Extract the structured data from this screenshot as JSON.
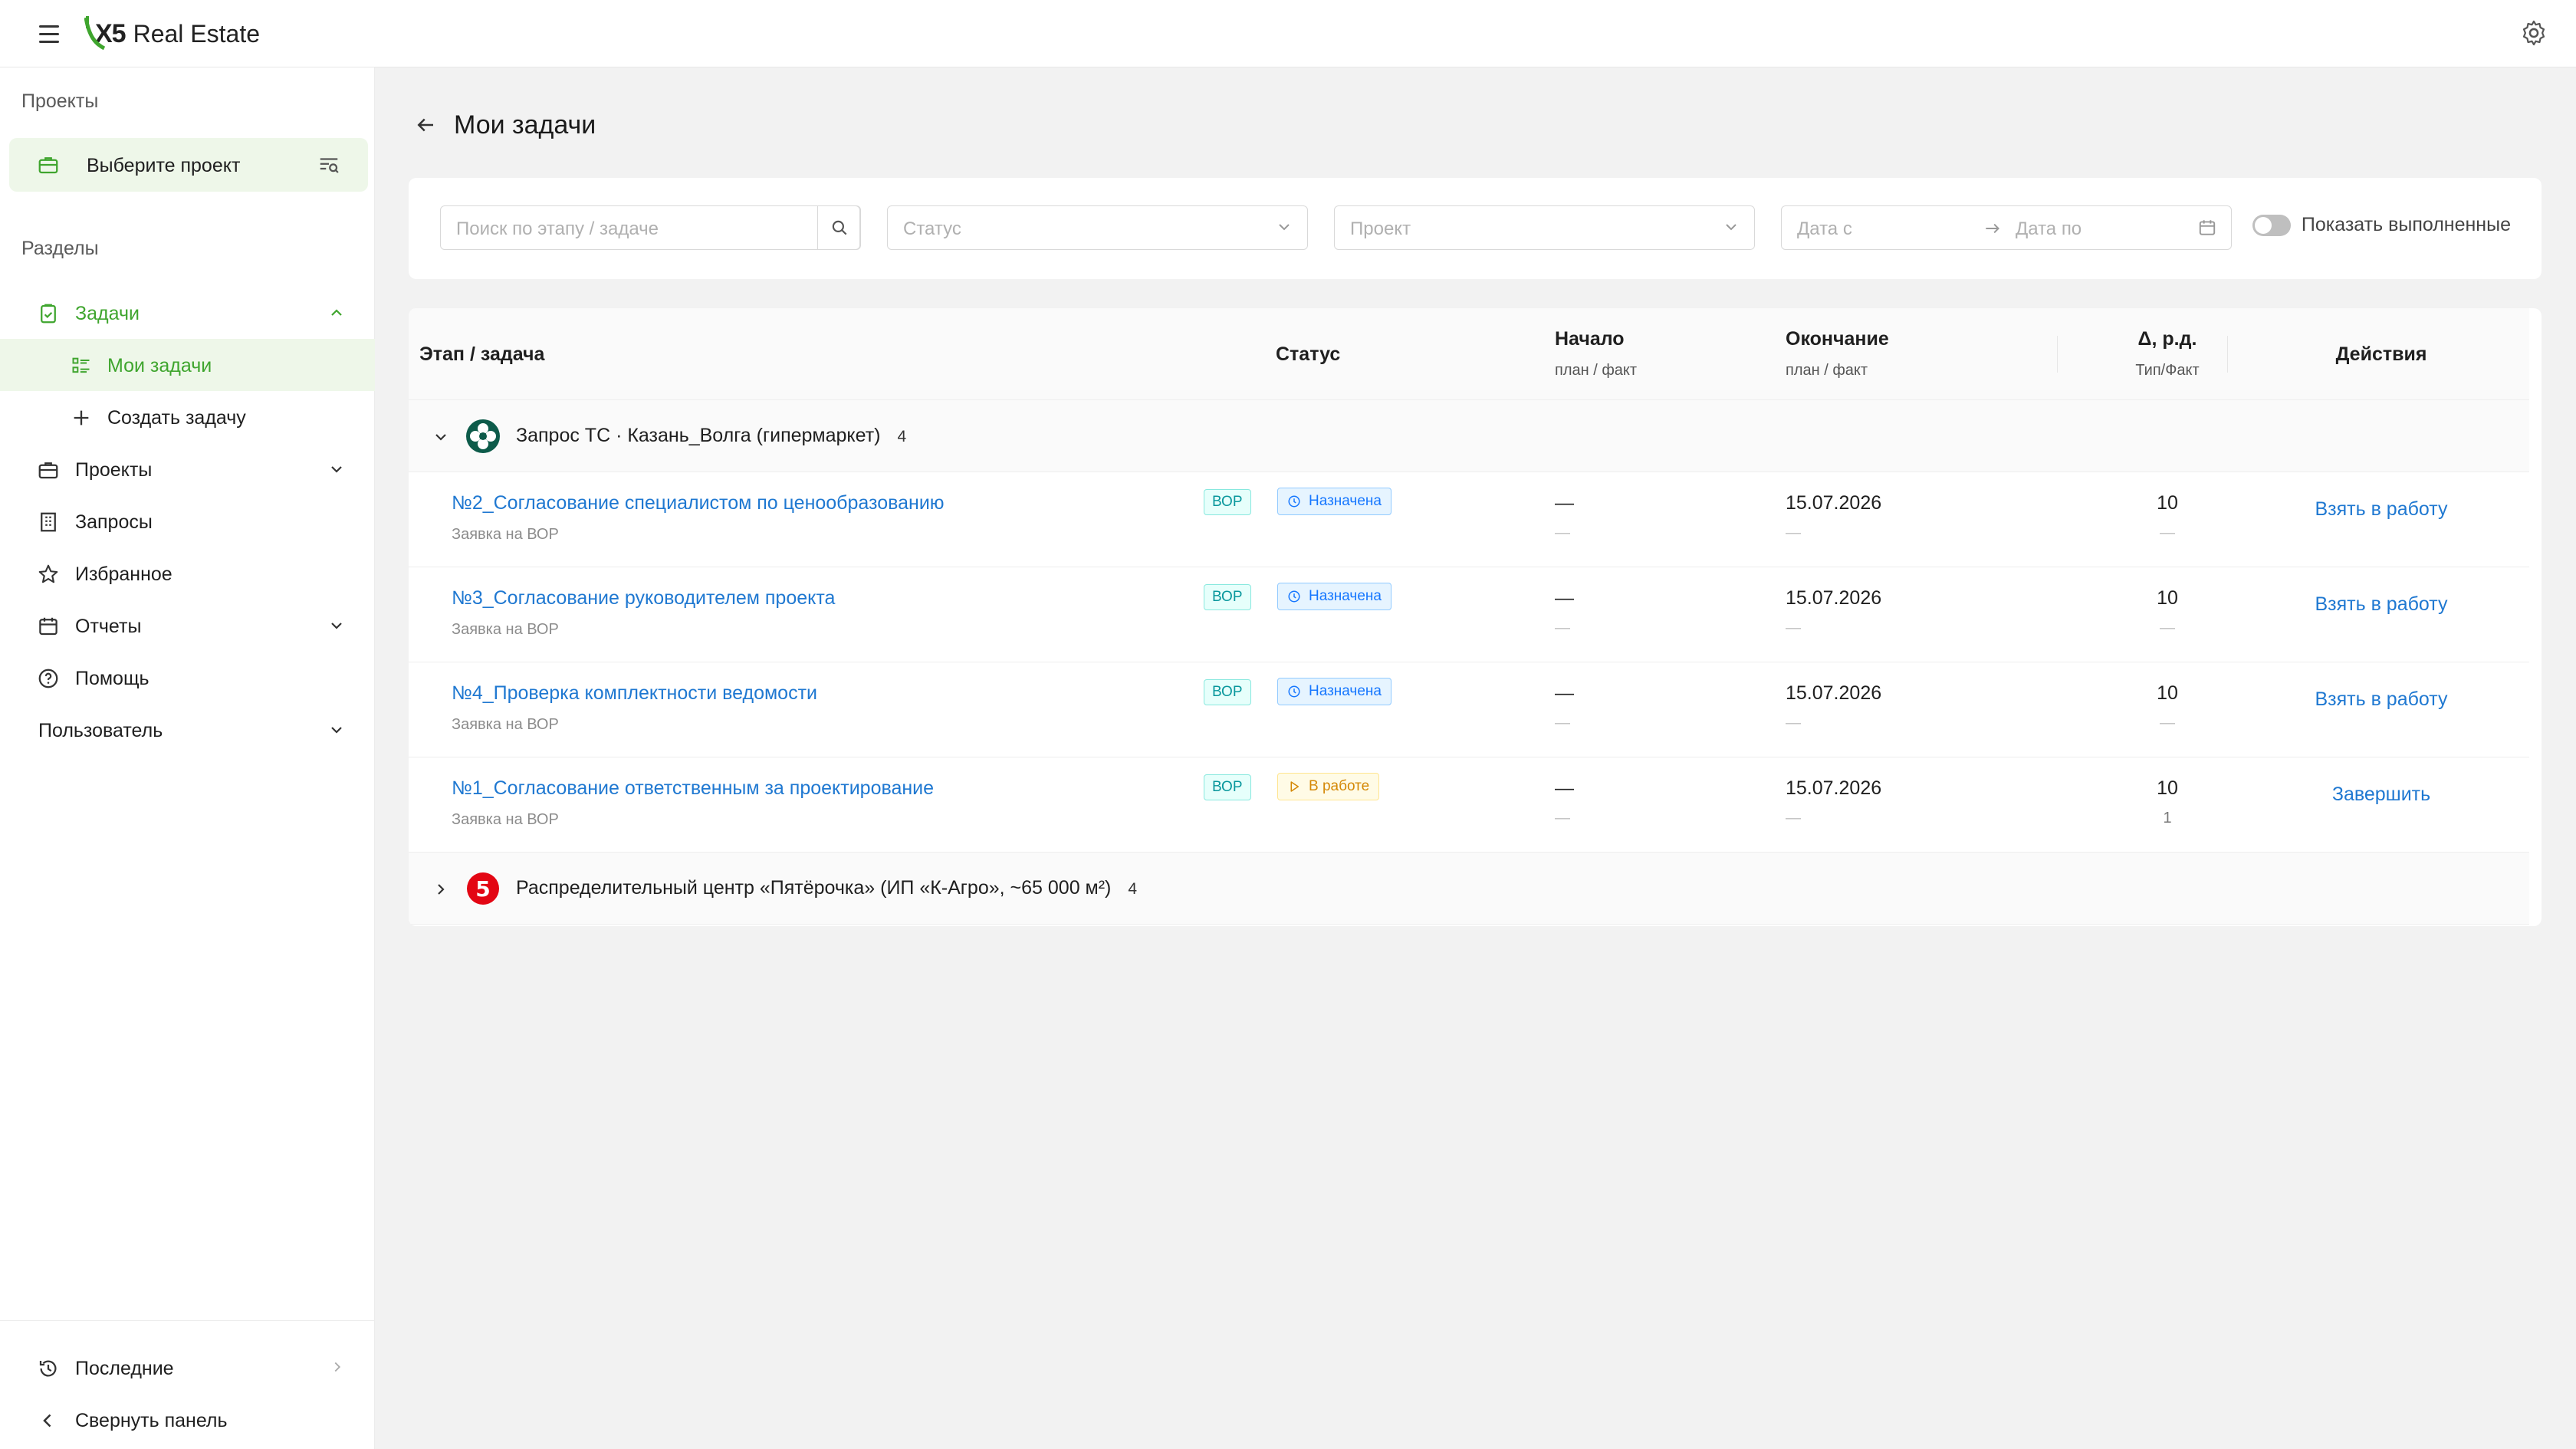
{
  "header": {
    "brand_mark": "X5",
    "brand_text": "Real Estate",
    "icons": [
      "menu-icon",
      "gear-icon"
    ]
  },
  "sidebar": {
    "projects_section": "Проекты",
    "project_select_label": "Выберите проект",
    "sections_title": "Разделы",
    "items": [
      {
        "label": "Задачи",
        "icon": "task-icon",
        "expanded": true
      },
      {
        "label": "Мои задачи",
        "icon": "list-icon",
        "selected": true
      },
      {
        "label": "Создать задачу",
        "icon": "plus-icon"
      },
      {
        "label": "Проекты",
        "icon": "folder-icon",
        "expandable": true
      },
      {
        "label": "Запросы",
        "icon": "building-icon"
      },
      {
        "label": "Избранное",
        "icon": "star-icon"
      },
      {
        "label": "Отчеты",
        "icon": "calendar-icon",
        "expandable": true
      },
      {
        "label": "Помощь",
        "icon": "help-icon"
      },
      {
        "label": "Пользователь",
        "expandable": true
      }
    ],
    "recent": "Последние",
    "collapse": "Свернуть панель"
  },
  "page": {
    "title": "Мои задачи"
  },
  "filters": {
    "search_placeholder": "Поиск по этапу / задаче",
    "status_placeholder": "Статус",
    "project_placeholder": "Проект",
    "date_from_placeholder": "Дата с",
    "date_to_placeholder": "Дата по",
    "show_done_label": "Показать выполненные",
    "show_done": false
  },
  "table": {
    "columns": {
      "stage": "Этап / задача",
      "status": "Статус",
      "start": "Начало",
      "start_sub": "план / факт",
      "end": "Окончание",
      "end_sub": "план / факт",
      "delta": "Δ, р.д.",
      "delta_sub": "Тип/Факт",
      "actions": "Действия"
    },
    "groups": [
      {
        "name": "Запрос ТС · Казань_Волга (гипермаркет)",
        "count": "4",
        "expanded": true,
        "icon": "perekrestok-logo-icon",
        "tasks": [
          {
            "title": "№2_Согласование специалистом по ценообразованию",
            "sub": "Заявка на ВОР",
            "tag": "ВОР",
            "status": "Назначена",
            "status_kind": "assigned",
            "start_plan": "—",
            "start_fact": "—",
            "end_plan": "15.07.2026",
            "end_fact": "—",
            "delta_type": "10",
            "delta_fact": "—",
            "action": "Взять в работу"
          },
          {
            "title": "№3_Согласование руководителем проекта",
            "sub": "Заявка на ВОР",
            "tag": "ВОР",
            "status": "Назначена",
            "status_kind": "assigned",
            "start_plan": "—",
            "start_fact": "—",
            "end_plan": "15.07.2026",
            "end_fact": "—",
            "delta_type": "10",
            "delta_fact": "—",
            "action": "Взять в работу"
          },
          {
            "title": "№4_Проверка комплектности ведомости",
            "sub": "Заявка на ВОР",
            "tag": "ВОР",
            "status": "Назначена",
            "status_kind": "assigned",
            "start_plan": "—",
            "start_fact": "—",
            "end_plan": "15.07.2026",
            "end_fact": "—",
            "delta_type": "10",
            "delta_fact": "—",
            "action": "Взять в работу"
          },
          {
            "title": "№1_Согласование ответственным за проектирование",
            "sub": "Заявка на ВОР",
            "tag": "ВОР",
            "status": "В работе",
            "status_kind": "inwork",
            "start_plan": "—",
            "start_fact": "—",
            "end_plan": "15.07.2026",
            "end_fact": "—",
            "delta_type": "10",
            "delta_fact": "1",
            "action": "Завершить"
          }
        ]
      },
      {
        "name": "Распределительный центр «Пятёрочка» (ИП «К-Агро», ~65 000 м²)",
        "count": "4",
        "expanded": false,
        "icon": "pyaterochka-logo-icon"
      }
    ]
  },
  "colors": {
    "accent_green": "#3fa52e",
    "link_blue": "#1f78d1",
    "tag_teal": "#08979c",
    "status_blue": "#1677ff",
    "status_yellow": "#d48806"
  }
}
